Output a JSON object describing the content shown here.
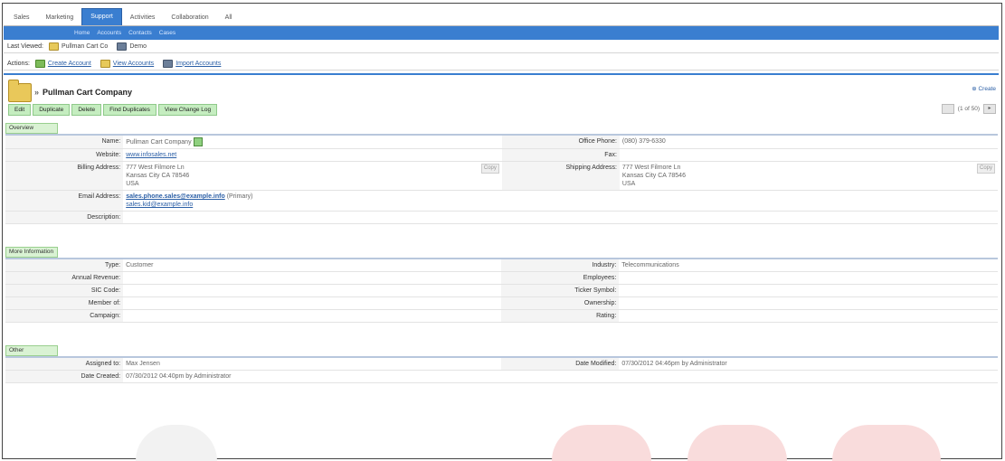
{
  "tabs": [
    {
      "label": "Sales",
      "active": false
    },
    {
      "label": "Marketing",
      "active": false
    },
    {
      "label": "Support",
      "active": true
    },
    {
      "label": "Activities",
      "active": false
    },
    {
      "label": "Collaboration",
      "active": false
    },
    {
      "label": "All",
      "active": false
    }
  ],
  "subnav": [
    "Home",
    "Accounts",
    "Contacts",
    "Cases"
  ],
  "last_viewed": {
    "label": "Last Viewed:",
    "items": [
      {
        "icon": "folder-icon",
        "text": "Pullman Cart Co"
      },
      {
        "icon": "document-icon",
        "text": "Demo"
      }
    ]
  },
  "actions": {
    "label": "Actions:",
    "items": [
      {
        "icon": "create-account-icon",
        "text": "Create Account"
      },
      {
        "icon": "folder-icon",
        "text": "View Accounts"
      },
      {
        "icon": "import-icon",
        "text": "Import Accounts"
      }
    ]
  },
  "record": {
    "title": "Pullman Cart Company",
    "create_link": "Create",
    "buttons": [
      "Edit",
      "Duplicate",
      "Delete",
      "Find Duplicates",
      "View Change Log"
    ],
    "pager_text": "(1 of 50)"
  },
  "overview": {
    "heading": "Overview",
    "name_label": "Name:",
    "name": "Pullman Cart Company",
    "office_phone_label": "Office Phone:",
    "office_phone": "(080) 379-6330",
    "website_label": "Website:",
    "website": "www.infosales.net",
    "fax_label": "Fax:",
    "fax": "",
    "billing_label": "Billing Address:",
    "billing": [
      "777 West Filmore Ln",
      "Kansas City CA 78546",
      "USA"
    ],
    "shipping_label": "Shipping Address:",
    "shipping": [
      "777 West Filmore Ln",
      "Kansas City CA 78546",
      "USA"
    ],
    "copy_label": "Copy",
    "email_label": "Email Address:",
    "email_primary": "sales.phone.sales@example.info",
    "email_primary_tag": "(Primary)",
    "email_secondary": "sales.kid@example.info",
    "description_label": "Description:",
    "description": ""
  },
  "more_info": {
    "heading": "More Information",
    "rows": [
      {
        "l1": "Type:",
        "v1": "Customer",
        "l2": "Industry:",
        "v2": "Telecommunications"
      },
      {
        "l1": "Annual Revenue:",
        "v1": "",
        "l2": "Employees:",
        "v2": ""
      },
      {
        "l1": "SIC Code:",
        "v1": "",
        "l2": "Ticker Symbol:",
        "v2": ""
      },
      {
        "l1": "Member of:",
        "v1": "",
        "l2": "Ownership:",
        "v2": ""
      },
      {
        "l1": "Campaign:",
        "v1": "",
        "l2": "Rating:",
        "v2": ""
      }
    ]
  },
  "other": {
    "heading": "Other",
    "assigned_label": "Assigned to:",
    "assigned": "Max Jensen",
    "modified_label": "Date Modified:",
    "modified": "07/30/2012 04:46pm by Administrator",
    "created_label": "Date Created:",
    "created": "07/30/2012 04:40pm by Administrator"
  },
  "colors": {
    "accent": "#3a7ed0",
    "button_green": "#c5edc0",
    "link": "#2b5fa6"
  }
}
